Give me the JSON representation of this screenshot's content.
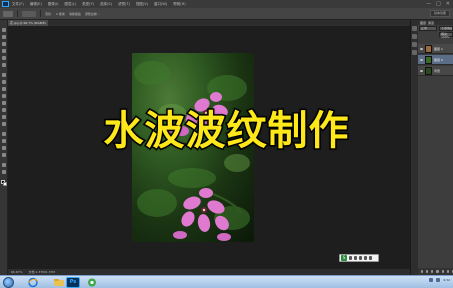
{
  "app": {
    "menu": [
      "文件(F)",
      "编辑(E)",
      "图像(I)",
      "图层(L)",
      "类型(Y)",
      "选择(S)",
      "滤镜(T)",
      "视图(V)",
      "窗口(W)",
      "帮助(H)"
    ],
    "window_controls": [
      "—",
      "□",
      "✕"
    ]
  },
  "options_bar": {
    "feather_label": "羽化:",
    "feather_value": "0 像素",
    "antialias_label": "消除锯齿",
    "refine_label": "调整边缘...",
    "workspace": "基本功能"
  },
  "document": {
    "tab_label": "花.jpg @ 66.7% (RGB/8)",
    "zoom": "66.67%",
    "status": "文档:1.37M/1.37M"
  },
  "layers_panel": {
    "tab": "图层",
    "tab2": "通道",
    "blend_mode": "正常",
    "opacity": "不透明度: 100%",
    "fill": "填充: 100%",
    "layers": [
      {
        "name": "图层 1",
        "active": false,
        "thumb": "#9a6a3e"
      },
      {
        "name": "图层 0",
        "active": true,
        "thumb": "#3b6b28"
      },
      {
        "name": "背景",
        "active": false,
        "thumb": "#2a4a1e"
      }
    ]
  },
  "caption": "水波波纹制作",
  "taskbar": {
    "ps_label": "Ps",
    "time": "9:32"
  },
  "colors": {
    "caption": "#ffe81a",
    "ps_accent": "#31a8ff",
    "active_layer": "#5c6e87"
  }
}
